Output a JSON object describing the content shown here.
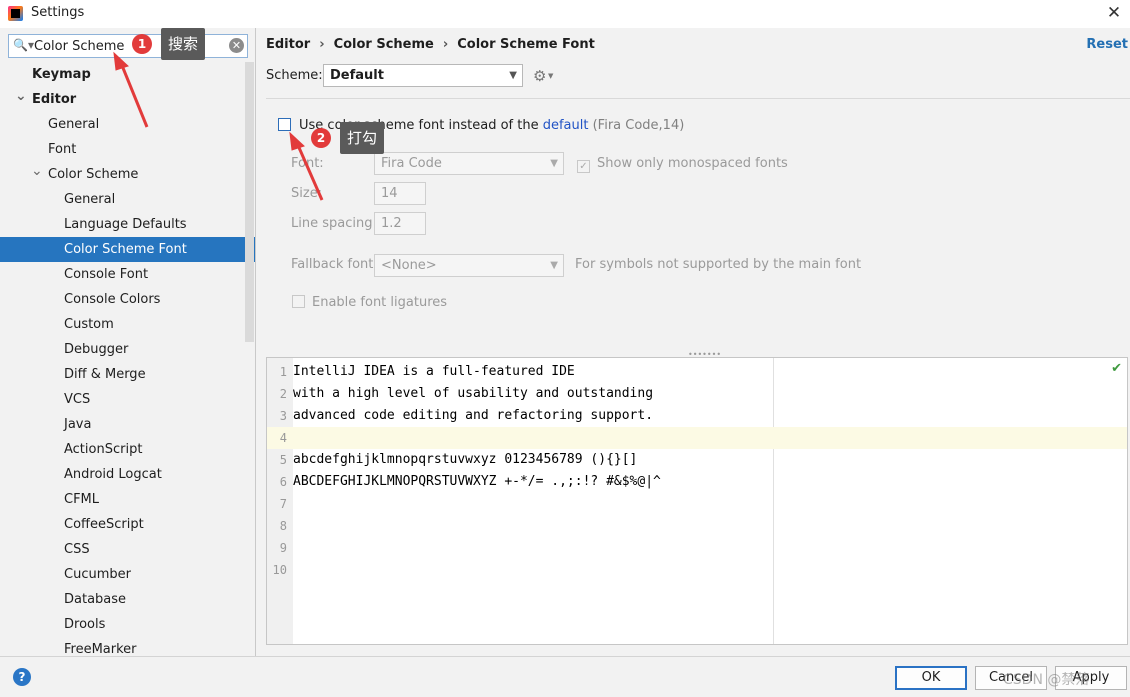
{
  "window": {
    "title": "Settings",
    "close_glyph": "✕"
  },
  "search": {
    "value": "Color Scheme",
    "placeholder": ""
  },
  "tree": [
    {
      "label": "Keymap",
      "level": 0,
      "bold": true
    },
    {
      "label": "Editor",
      "level": 0,
      "bold": true,
      "expanded": true
    },
    {
      "label": "General",
      "level": 1
    },
    {
      "label": "Font",
      "level": 1
    },
    {
      "label": "Color Scheme",
      "level": 1,
      "expanded": true
    },
    {
      "label": "General",
      "level": 2
    },
    {
      "label": "Language Defaults",
      "level": 2
    },
    {
      "label": "Color Scheme Font",
      "level": 2,
      "selected": true
    },
    {
      "label": "Console Font",
      "level": 2
    },
    {
      "label": "Console Colors",
      "level": 2
    },
    {
      "label": "Custom",
      "level": 2
    },
    {
      "label": "Debugger",
      "level": 2
    },
    {
      "label": "Diff & Merge",
      "level": 2
    },
    {
      "label": "VCS",
      "level": 2
    },
    {
      "label": "Java",
      "level": 2
    },
    {
      "label": "ActionScript",
      "level": 2
    },
    {
      "label": "Android Logcat",
      "level": 2
    },
    {
      "label": "CFML",
      "level": 2
    },
    {
      "label": "CoffeeScript",
      "level": 2
    },
    {
      "label": "CSS",
      "level": 2
    },
    {
      "label": "Cucumber",
      "level": 2
    },
    {
      "label": "Database",
      "level": 2
    },
    {
      "label": "Drools",
      "level": 2
    },
    {
      "label": "FreeMarker",
      "level": 2
    }
  ],
  "breadcrumb": {
    "items": [
      "Editor",
      "Color Scheme",
      "Color Scheme Font"
    ],
    "separator": "›"
  },
  "reset_label": "Reset",
  "scheme": {
    "label": "Scheme:",
    "value": "Default"
  },
  "use_scheme_font": {
    "checked": false,
    "label_prefix": "Use color scheme font instead of the ",
    "link": "default",
    "suffix": " (Fira Code,14)"
  },
  "font": {
    "label": "Font:",
    "value": "Fira Code"
  },
  "monospaced": {
    "label": "Show only monospaced fonts",
    "checked": true
  },
  "size": {
    "label": "Size:",
    "value": "14"
  },
  "line_spacing": {
    "label": "Line spacing:",
    "value": "1.2"
  },
  "fallback": {
    "label": "Fallback font:",
    "value": "<None>",
    "hint": "For symbols not supported by the main font"
  },
  "ligatures": {
    "label": "Enable font ligatures",
    "checked": false
  },
  "preview": {
    "lines": [
      "IntelliJ IDEA is a full-featured IDE",
      "with a high level of usability and outstanding",
      "advanced code editing and refactoring support.",
      "",
      "abcdefghijklmnopqrstuvwxyz 0123456789 (){}[]",
      "ABCDEFGHIJKLMNOPQRSTUVWXYZ +-*/= .,;:!? #&$%@|^",
      "",
      "",
      "",
      ""
    ],
    "current_line": 4
  },
  "buttons": {
    "ok": "OK",
    "cancel": "Cancel",
    "apply": "Apply"
  },
  "annotations": [
    {
      "number": "1",
      "text": "搜索"
    },
    {
      "number": "2",
      "text": "打勾"
    }
  ],
  "watermark": "CSDN @禁落",
  "colors": {
    "selection": "#2675bf",
    "link": "#2153c5",
    "annotation": "#e23b3b"
  }
}
